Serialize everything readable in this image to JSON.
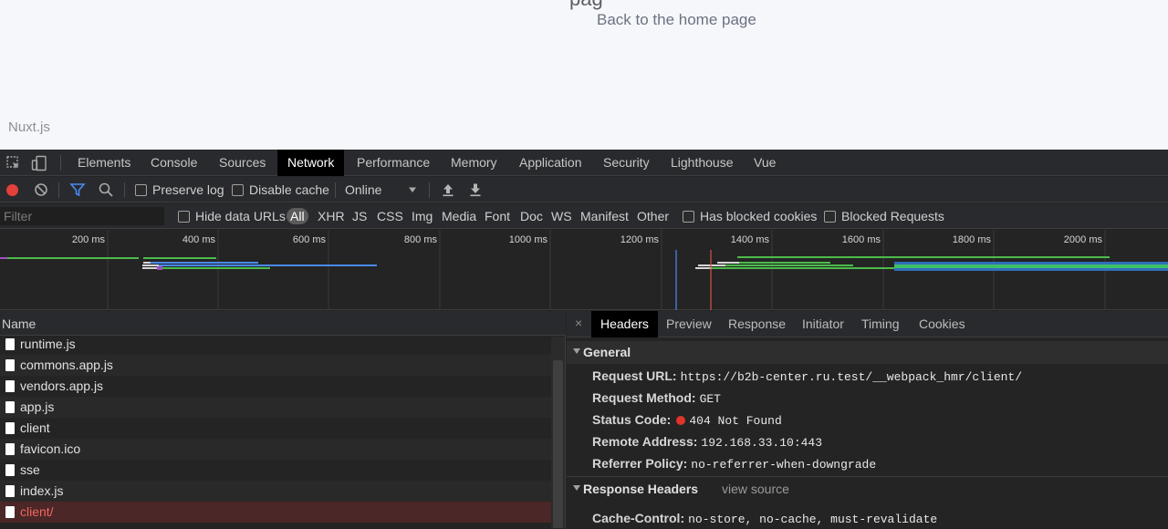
{
  "page": {
    "clipped_heading": "pag",
    "home_link": "Back to the home page",
    "brand": "Nuxt.js"
  },
  "devtools": {
    "tabs": [
      "Elements",
      "Console",
      "Sources",
      "Network",
      "Performance",
      "Memory",
      "Application",
      "Security",
      "Lighthouse",
      "Vue"
    ],
    "active_tab": "Network",
    "toolbar": {
      "preserve_log": "Preserve log",
      "disable_cache": "Disable cache",
      "throttle": "Online"
    },
    "filter": {
      "placeholder": "Filter",
      "hide_data_urls": "Hide data URLs",
      "types": [
        "All",
        "XHR",
        "JS",
        "CSS",
        "Img",
        "Media",
        "Font",
        "Doc",
        "WS",
        "Manifest",
        "Other"
      ],
      "has_blocked_cookies": "Has blocked cookies",
      "blocked_requests": "Blocked Requests"
    },
    "overview": {
      "ticks": [
        "200 ms",
        "400 ms",
        "600 ms",
        "800 ms",
        "1000 ms",
        "1200 ms",
        "1400 ms",
        "1600 ms",
        "1800 ms",
        "2000 ms"
      ]
    },
    "requests": {
      "column": "Name",
      "rows": [
        "runtime.js",
        "commons.app.js",
        "vendors.app.js",
        "app.js",
        "client",
        "favicon.ico",
        "sse",
        "index.js",
        "client/"
      ],
      "error_row": "client/"
    },
    "details": {
      "tabs": [
        "Headers",
        "Preview",
        "Response",
        "Initiator",
        "Timing",
        "Cookies"
      ],
      "active_tab": "Headers",
      "close": "×",
      "general_title": "General",
      "general": [
        {
          "key": "Request URL:",
          "value": "https://b2b-center.ru.test/__webpack_hmr/client/"
        },
        {
          "key": "Request Method:",
          "value": "GET"
        },
        {
          "key": "Status Code:",
          "value": "404 Not Found"
        },
        {
          "key": "Remote Address:",
          "value": "192.168.33.10:443"
        },
        {
          "key": "Referrer Policy:",
          "value": "no-referrer-when-downgrade"
        }
      ],
      "response_title": "Response Headers",
      "view_source": "view source",
      "response": [
        {
          "key": "Cache-Control:",
          "value": "no-store, no-cache, must-revalidate"
        }
      ]
    },
    "colors": {
      "record": "#e2403a",
      "status_error": "#e0342b",
      "error_text": "#f0685f",
      "active_filter": "#4a8af4"
    }
  }
}
